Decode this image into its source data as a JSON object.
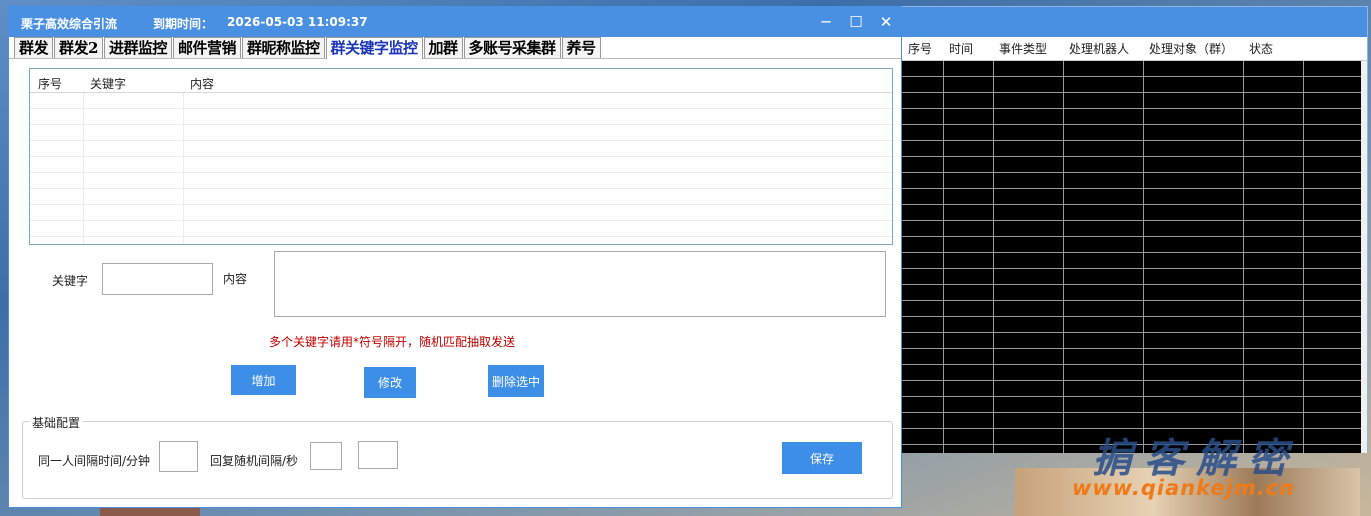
{
  "main_window": {
    "app_title": "栗子高效综合引流",
    "expire_label": "到期时间：",
    "expire_value": "2026-05-03 11:09:37",
    "controls": {
      "minimize": "─",
      "maximize": "☐",
      "close": "✕"
    }
  },
  "tabs": [
    {
      "label": "群发"
    },
    {
      "label": "群发2"
    },
    {
      "label": "进群监控"
    },
    {
      "label": "邮件营销"
    },
    {
      "label": "群昵称监控"
    },
    {
      "label": "群关键字监控"
    },
    {
      "label": "加群"
    },
    {
      "label": "多账号采集群"
    },
    {
      "label": "养号"
    }
  ],
  "active_tab": "群关键字监控",
  "keyword_table": {
    "columns": [
      "序号",
      "关键字",
      "内容"
    ],
    "rows": []
  },
  "form": {
    "keyword_label": "关键字",
    "keyword_value": "",
    "content_label": "内容",
    "content_value": "",
    "hint": "多个关键字请用*符号隔开，随机匹配抽取发送",
    "add_button": "增加",
    "modify_button": "修改",
    "delete_button": "删除选中"
  },
  "basic_config": {
    "legend": "基础配置",
    "interval_label": "同一人间隔时间/分钟",
    "interval_value": "",
    "reply_label": "回复随机间隔/秒",
    "reply_min": "",
    "reply_max": "",
    "save_button": "保存"
  },
  "log_window": {
    "columns": [
      "序号",
      "时间",
      "事件类型",
      "处理机器人",
      "处理对象（群）",
      "状态"
    ],
    "rows": []
  },
  "watermark": {
    "text": "掮客解密",
    "url": "www.qiankejm.cn"
  },
  "colors": {
    "accent": "#4a90e2",
    "button": "#3d8ee6",
    "hint": "#c00000",
    "active_tab": "#1a35b8"
  }
}
